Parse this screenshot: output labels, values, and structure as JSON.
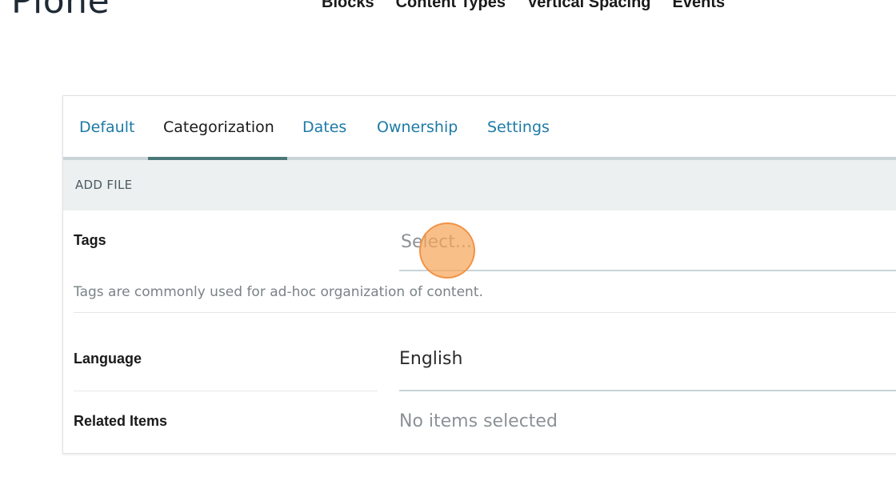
{
  "header": {
    "logo_text": "Plone",
    "nav": [
      "Blocks",
      "Content Types",
      "Vertical Spacing",
      "Events"
    ]
  },
  "tabs": [
    {
      "label": "Default",
      "active": false
    },
    {
      "label": "Categorization",
      "active": true
    },
    {
      "label": "Dates",
      "active": false
    },
    {
      "label": "Ownership",
      "active": false
    },
    {
      "label": "Settings",
      "active": false
    }
  ],
  "section": {
    "title": "ADD FILE"
  },
  "fields": {
    "tags": {
      "label": "Tags",
      "placeholder": "Select...",
      "help": "Tags are commonly used for ad-hoc organization of content."
    },
    "language": {
      "label": "Language",
      "value": "English"
    },
    "related_items": {
      "label": "Related Items",
      "value": "No items selected"
    }
  },
  "colors": {
    "link": "#1e7aa6",
    "tab_active_underline": "#4a7777",
    "section_bg": "#ecf0f1",
    "click_indicator": "#f6a65c"
  }
}
